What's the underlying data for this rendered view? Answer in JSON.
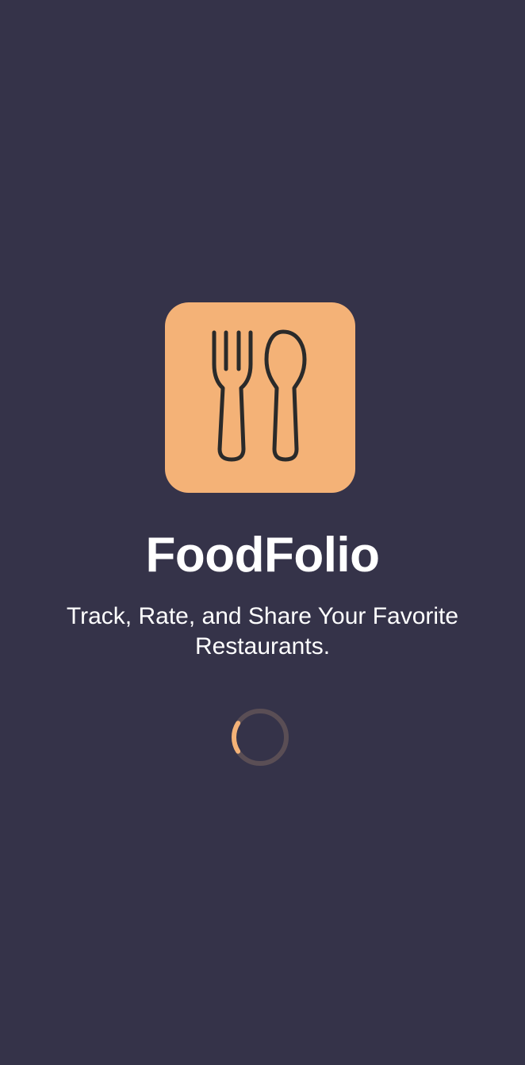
{
  "app": {
    "name": "FoodFolio",
    "tagline": "Track, Rate, and Share Your Favorite Restaurants.",
    "icon": "fork-and-spoon-icon"
  },
  "loading": {
    "indicator": "loading-spinner",
    "progress": 0.18
  },
  "colors": {
    "background": "#353349",
    "accent": "#f4b277",
    "icon_stroke": "#2a2a2a",
    "text": "#ffffff",
    "spinner_track": "#5a4e55"
  }
}
